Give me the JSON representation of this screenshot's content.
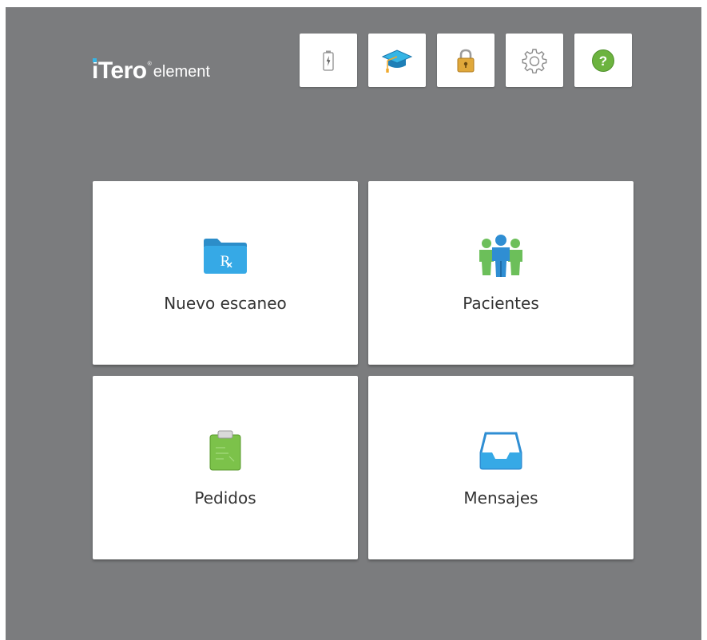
{
  "app": {
    "logo_main": "iTero",
    "logo_reg": "®",
    "logo_sub": "element"
  },
  "toolbar": {
    "buttons": [
      {
        "name": "battery",
        "icon": "battery-icon"
      },
      {
        "name": "training",
        "icon": "graduation-cap-icon"
      },
      {
        "name": "lock",
        "icon": "lock-icon"
      },
      {
        "name": "settings",
        "icon": "gear-icon"
      },
      {
        "name": "help",
        "icon": "help-icon",
        "glyph": "?"
      }
    ]
  },
  "tiles": [
    {
      "label": "Nuevo escaneo",
      "icon": "rx-folder-icon",
      "glyph": "R"
    },
    {
      "label": "Pacientes",
      "icon": "patients-group-icon"
    },
    {
      "label": "Pedidos",
      "icon": "clipboard-icon"
    },
    {
      "label": "Mensajes",
      "icon": "inbox-tray-icon"
    }
  ],
  "colors": {
    "background": "#7b7c7e",
    "accent_blue": "#36b5e5",
    "help_green": "#6cb33f",
    "lock_gold": "#e0a83a",
    "clipboard_green": "#7cc24a"
  }
}
